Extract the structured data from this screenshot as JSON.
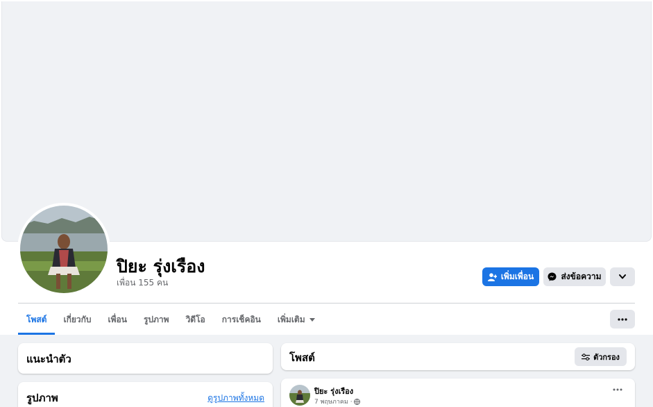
{
  "profile": {
    "name": "ปิยะ รุ่งเรือง",
    "friends_count": "เพื่อน 155 คน"
  },
  "actions": {
    "add_friend": "เพิ่มเพื่อน",
    "message": "ส่งข้อความ"
  },
  "tabs": [
    {
      "label": "โพสต์",
      "active": true
    },
    {
      "label": "เกี่ยวกับ"
    },
    {
      "label": "เพื่อน"
    },
    {
      "label": "รูปภาพ"
    },
    {
      "label": "วิดีโอ"
    },
    {
      "label": "การเช็คอิน"
    },
    {
      "label": "เพิ่มเติม"
    }
  ],
  "intro": {
    "title": "แนะนำตัว"
  },
  "photos": {
    "title": "รูปภาพ",
    "see_all": "ดูรูปภาพทั้งหมด"
  },
  "posts": {
    "title": "โพสต์",
    "filter_label": "ตัวกรอง"
  },
  "post": {
    "author": "ปิยะ รุ่งเรือง",
    "date": "7 พฤษภาคม ·"
  },
  "colors": {
    "accent": "#1b74e4",
    "background": "#f0f2f5",
    "secondary_button": "#e4e6eb",
    "muted_text": "#65676b"
  },
  "icons": [
    "add-friend-icon",
    "messenger-icon",
    "chevron-down-icon",
    "more-horizontal-icon",
    "caret-down-icon",
    "filter-sliders-icon",
    "globe-icon"
  ]
}
